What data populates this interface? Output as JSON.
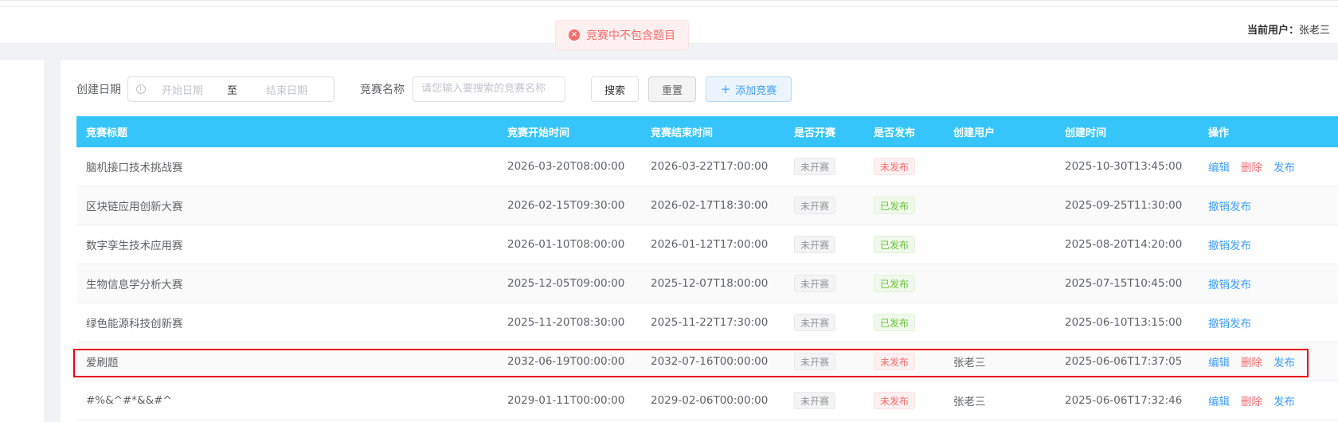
{
  "header": {
    "current_user_label": "当前用户：",
    "current_user_name": "张老三"
  },
  "toast": {
    "message": "竞赛中不包含题目",
    "icon": "close-circle-icon",
    "color": "#f56c6c"
  },
  "filters": {
    "date_label": "创建日期",
    "start_placeholder": "开始日期",
    "range_separator": "至",
    "end_placeholder": "结束日期",
    "name_label": "竞赛名称",
    "name_placeholder": "请您输入要搜索的竞赛名称",
    "search_button": "搜索",
    "reset_button": "重置",
    "add_button": "添加竞赛"
  },
  "table": {
    "header_color": "#36c5fa",
    "columns": [
      "竞赛标题",
      "竞赛开始时间",
      "竞赛结束时间",
      "是否开赛",
      "是否发布",
      "创建用户",
      "创建时间",
      "操作"
    ],
    "rows": [
      {
        "title": "脑机接口技术挑战赛",
        "start": "2026-03-20T08:00:00",
        "end": "2026-03-22T17:00:00",
        "started": "未开赛",
        "published": "未发布",
        "pub_state": "danger",
        "creator": "",
        "created": "2025-10-30T13:45:00",
        "actions": [
          "编辑",
          "删除",
          "发布"
        ]
      },
      {
        "title": "区块链应用创新大赛",
        "start": "2026-02-15T09:30:00",
        "end": "2026-02-17T18:30:00",
        "started": "未开赛",
        "published": "已发布",
        "pub_state": "success",
        "creator": "",
        "created": "2025-09-25T11:30:00",
        "actions": [
          "撤销发布"
        ]
      },
      {
        "title": "数字孪生技术应用赛",
        "start": "2026-01-10T08:00:00",
        "end": "2026-01-12T17:00:00",
        "started": "未开赛",
        "published": "已发布",
        "pub_state": "success",
        "creator": "",
        "created": "2025-08-20T14:20:00",
        "actions": [
          "撤销发布"
        ]
      },
      {
        "title": "生物信息学分析大赛",
        "start": "2025-12-05T09:00:00",
        "end": "2025-12-07T18:00:00",
        "started": "未开赛",
        "published": "已发布",
        "pub_state": "success",
        "creator": "",
        "created": "2025-07-15T10:45:00",
        "actions": [
          "撤销发布"
        ]
      },
      {
        "title": "绿色能源科技创新赛",
        "start": "2025-11-20T08:30:00",
        "end": "2025-11-22T17:30:00",
        "started": "未开赛",
        "published": "已发布",
        "pub_state": "success",
        "creator": "",
        "created": "2025-06-10T13:15:00",
        "actions": [
          "撤销发布"
        ]
      },
      {
        "title": "爱刷题",
        "start": "2032-06-19T00:00:00",
        "end": "2032-07-16T00:00:00",
        "started": "未开赛",
        "published": "未发布",
        "pub_state": "danger",
        "creator": "张老三",
        "created": "2025-06-06T17:37:05",
        "actions": [
          "编辑",
          "删除",
          "发布"
        ]
      },
      {
        "title": "#%&^#*&&#^",
        "start": "2029-01-11T00:00:00",
        "end": "2029-02-06T00:00:00",
        "started": "未开赛",
        "published": "未发布",
        "pub_state": "danger",
        "creator": "张老三",
        "created": "2025-06-06T17:32:46",
        "actions": [
          "编辑",
          "删除",
          "发布"
        ]
      }
    ]
  }
}
